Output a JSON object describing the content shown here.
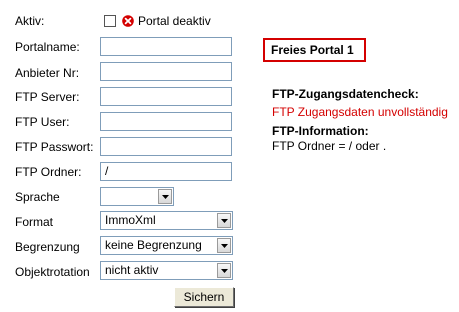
{
  "form": {
    "aktiv": {
      "label": "Aktiv:",
      "checked": false,
      "status_text": "Portal deaktiv",
      "status_icon": "error-x-icon"
    },
    "portalname": {
      "label": "Portalname:",
      "value": ""
    },
    "anbieter_nr": {
      "label": "Anbieter Nr:",
      "value": ""
    },
    "ftp_server": {
      "label": "FTP Server:",
      "value": ""
    },
    "ftp_user": {
      "label": "FTP User:",
      "value": ""
    },
    "ftp_passwort": {
      "label": "FTP Passwort:",
      "value": ""
    },
    "ftp_ordner": {
      "label": "FTP Ordner:",
      "value": "/"
    },
    "sprache": {
      "label": "Sprache",
      "value": ""
    },
    "format": {
      "label": "Format",
      "value": "ImmoXml"
    },
    "begrenzung": {
      "label": "Begrenzung",
      "value": "keine Begrenzung"
    },
    "objektrotation": {
      "label": "Objektrotation",
      "value": "nicht aktiv"
    },
    "submit_label": "Sichern"
  },
  "sidebar": {
    "title": "Freies Portal 1",
    "check_heading": "FTP-Zugangsdatencheck:",
    "check_status": "FTP Zugangsdaten unvollständig",
    "info_heading": "FTP-Information:",
    "info_text": "FTP Ordner = / oder ."
  },
  "colors": {
    "error": "#d40000",
    "input_border": "#7f9db9",
    "button_face": "#ece9d8"
  }
}
